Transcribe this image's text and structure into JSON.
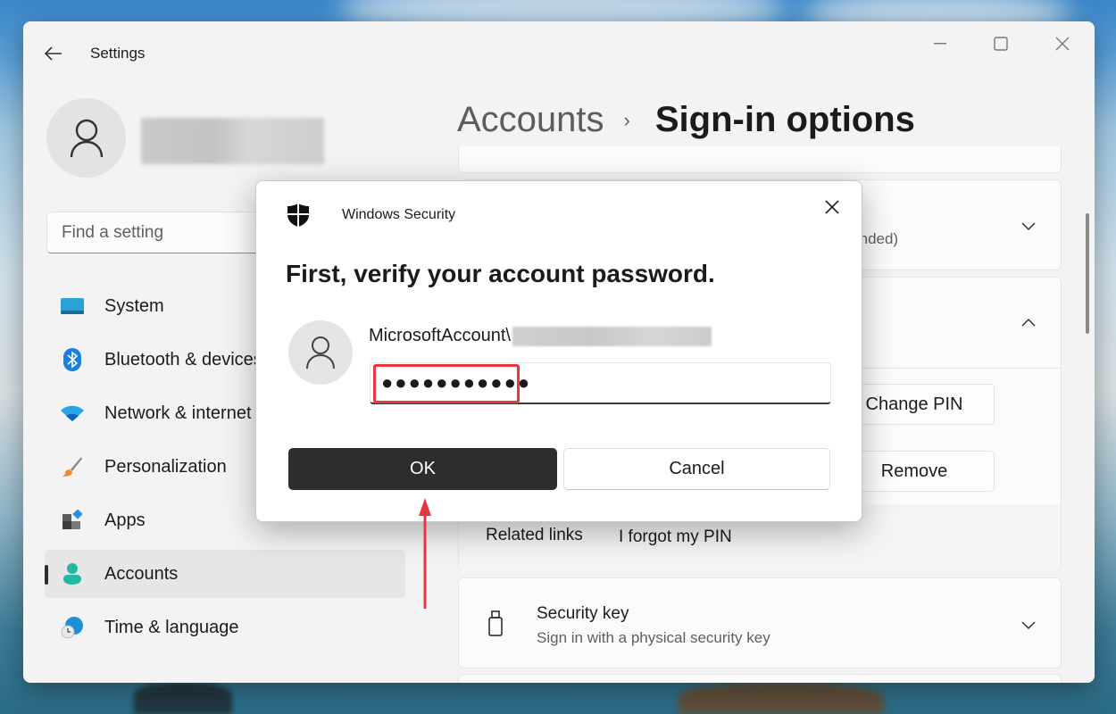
{
  "window": {
    "app_title": "Settings",
    "controls": {
      "minimize": "minimize-icon",
      "maximize": "maximize-icon",
      "close": "close-icon"
    }
  },
  "sidebar": {
    "search_placeholder": "Find a setting",
    "items": [
      {
        "label": "System",
        "icon": "monitor-icon",
        "selected": false
      },
      {
        "label": "Bluetooth & devices",
        "icon": "bluetooth-icon",
        "selected": false
      },
      {
        "label": "Network & internet",
        "icon": "wifi-icon",
        "selected": false
      },
      {
        "label": "Personalization",
        "icon": "paintbrush-icon",
        "selected": false
      },
      {
        "label": "Apps",
        "icon": "apps-icon",
        "selected": false
      },
      {
        "label": "Accounts",
        "icon": "person-icon",
        "selected": true
      },
      {
        "label": "Time & language",
        "icon": "globe-clock-icon",
        "selected": false
      }
    ]
  },
  "header": {
    "breadcrumb_parent": "Accounts",
    "breadcrumb_separator": "›",
    "breadcrumb_current": "Sign-in options"
  },
  "content": {
    "password_card": {
      "title_fragment": ")",
      "subtitle_fragment": "mended)"
    },
    "pin_card": {
      "change_pin_label": "Change PIN",
      "remove_label": "Remove",
      "related_links_label": "Related links",
      "forgot_pin_link": "I forgot my PIN"
    },
    "security_key_card": {
      "title": "Security key",
      "subtitle": "Sign in with a physical security key"
    }
  },
  "dialog": {
    "app_name": "Windows Security",
    "heading": "First, verify your account password.",
    "account_prefix": "MicrosoftAccount\\",
    "password_value": "●●●●●●●●●●●",
    "ok_label": "OK",
    "cancel_label": "Cancel"
  },
  "annotations": {
    "highlight_color": "#e8383e",
    "arrow_color": "#e8383e"
  }
}
